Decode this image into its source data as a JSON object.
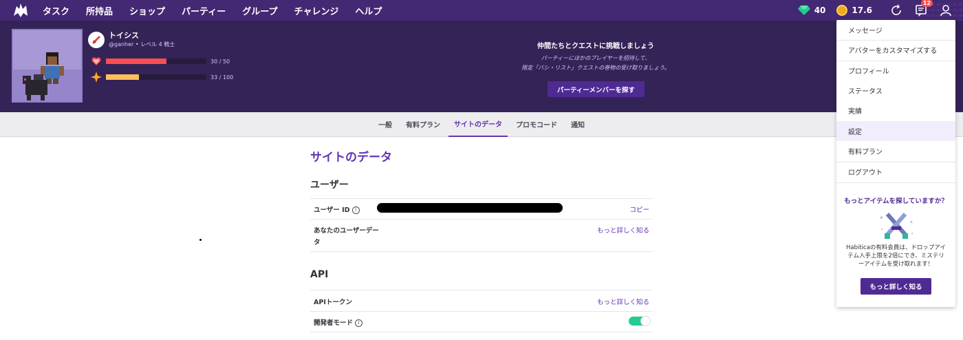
{
  "nav": {
    "items": [
      "タスク",
      "所持品",
      "ショップ",
      "パーティー",
      "グループ",
      "チャレンジ",
      "ヘルプ"
    ],
    "gems": "40",
    "gold": "17.6",
    "notifications_count": "12"
  },
  "profile": {
    "name": "トイシス",
    "level_line": "@ganher • レベル 4 戦士",
    "hp": {
      "text": "30 / 50",
      "value": 30,
      "max": 50,
      "color": "#f74e52"
    },
    "xp": {
      "text": "33 / 100",
      "value": 33,
      "max": 100,
      "color": "#ffbe5d"
    }
  },
  "party": {
    "title": "仲間たちとクエストに挑戦しましょう",
    "desc_line1": "パーティーにほかのプレイヤーを招待して、",
    "desc_line2": "限定「バシ・リスト」クエストの巻物の受け取りましょう。",
    "button": "パーティーメンバーを探す"
  },
  "tabs": [
    "一般",
    "有料プラン",
    "サイトのデータ",
    "プロモコード",
    "通知"
  ],
  "active_tab": "サイトのデータ",
  "main": {
    "page_title": "サイトのデータ",
    "user_section": "ユーザー",
    "user_id_label": "ユーザー ID",
    "copy_link": "コピー",
    "user_data_label_line1": "あなたのユーザーデー",
    "user_data_label_line2": "タ",
    "learn_more": "もっと詳しく知る",
    "api_section": "API",
    "api_token_label": "APIトークン",
    "dev_mode_label": "開発者モード",
    "dev_mode_on": true
  },
  "dropdown": {
    "items": [
      "メッセージ",
      "アバターをカスタマイズする",
      "プロフィール",
      "ステータス",
      "実績",
      "設定",
      "有料プラン",
      "ログアウト"
    ],
    "hovered": "設定",
    "promo_title": "もっとアイテムを探していますか？",
    "promo_text": "Habiticaの有料会員は、ドロップアイテム入手上限を2倍にでき、ミステリーアイテムを受け取れます！",
    "promo_button": "もっと詳しく知る"
  },
  "colors": {
    "nav_bg": "#432874",
    "header_bg": "#342356",
    "accent": "#6133b4",
    "toggle_on": "#24cc8f"
  }
}
